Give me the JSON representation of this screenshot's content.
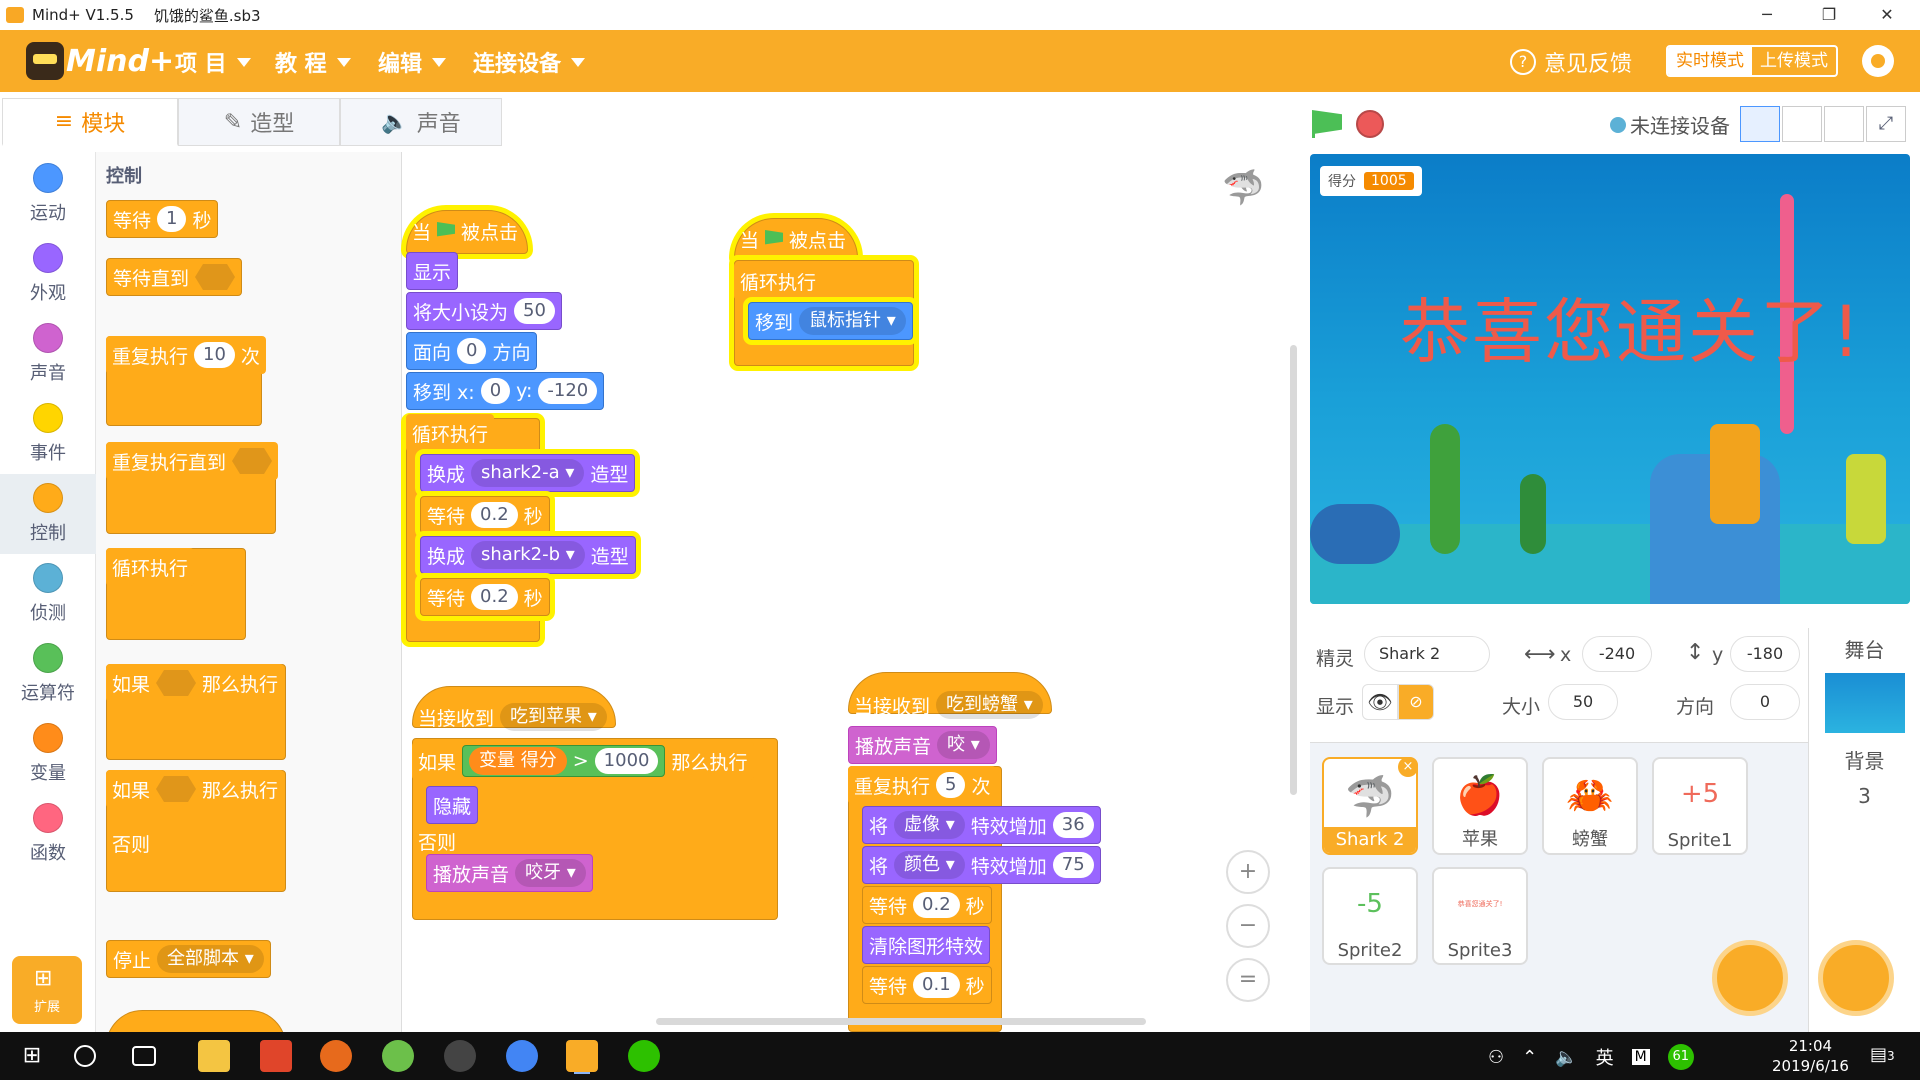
{
  "window": {
    "app": "Mind+ V1.5.5",
    "file": "饥饿的鲨鱼.sb3",
    "min": "─",
    "restore": "❐",
    "close": "✕"
  },
  "menubar": {
    "logo": "Mind+",
    "items": [
      "项 目",
      "教 程",
      "编辑",
      "连接设备"
    ],
    "feedback": "意见反馈",
    "mode_live": "实时模式",
    "mode_upload": "上传模式"
  },
  "tabs": [
    {
      "icon": "≡",
      "label": "模块"
    },
    {
      "icon": "✎",
      "label": "造型"
    },
    {
      "icon": "🔈",
      "label": "声音"
    }
  ],
  "categories": [
    {
      "label": "运动",
      "color": "#4c97ff"
    },
    {
      "label": "外观",
      "color": "#9966ff"
    },
    {
      "label": "声音",
      "color": "#cf63cf"
    },
    {
      "label": "事件",
      "color": "#ffd500"
    },
    {
      "label": "控制",
      "color": "#ffab19"
    },
    {
      "label": "侦测",
      "color": "#5cb1d6"
    },
    {
      "label": "运算符",
      "color": "#59c059"
    },
    {
      "label": "变量",
      "color": "#ff8c1a"
    },
    {
      "label": "函数",
      "color": "#ff6680"
    }
  ],
  "extensions_label": "扩展",
  "palette": {
    "heading": "控制",
    "wait": "等待",
    "wait_val": "1",
    "sec": "秒",
    "wait_until": "等待直到",
    "repeat": "重复执行",
    "repeat_val": "10",
    "times": "次",
    "repeat_until": "重复执行直到",
    "forever": "循环执行",
    "if": "如果",
    "then": "那么执行",
    "else": "否则",
    "stop": "停止",
    "stop_opt": "全部脚本"
  },
  "scripts": {
    "s1": {
      "when": "当",
      "clicked": "被点击",
      "show": "显示",
      "setsize": "将大小设为",
      "size_val": "50",
      "point": "面向",
      "dir_val": "0",
      "dir": "方向",
      "goto": "移到 x:",
      "x_val": "0",
      "y": "y:",
      "y_val": "-120",
      "forever": "循环执行",
      "switch": "换成",
      "costume_a": "shark2-a",
      "costume": "造型",
      "wait": "等待",
      "wait_val": "0.2",
      "sec": "秒",
      "costume_b": "shark2-b"
    },
    "s2": {
      "when": "当",
      "clicked": "被点击",
      "forever": "循环执行",
      "goto": "移到",
      "target": "鼠标指针"
    },
    "s3": {
      "recv": "当接收到",
      "msg": "吃到苹果",
      "if": "如果",
      "var": "变量",
      "varname": "得分",
      "gt": ">",
      "num": "1000",
      "then": "那么执行",
      "hide": "隐藏",
      "else": "否则",
      "play": "播放声音",
      "sound": "咬牙"
    },
    "s4": {
      "recv": "当接收到",
      "msg": "吃到螃蟹",
      "play": "播放声音",
      "sound": "咬",
      "repeat": "重复执行",
      "rep_val": "5",
      "times": "次",
      "set": "将",
      "eff1": "虚像",
      "inc": "特效增加",
      "v1": "36",
      "eff2": "颜色",
      "v2": "75",
      "wait": "等待",
      "w1": "0.2",
      "sec": "秒",
      "clear": "清除图形特效",
      "w2": "0.1"
    }
  },
  "zoom": {
    "in": "+",
    "out": "−",
    "reset": "="
  },
  "stage": {
    "connection": "未连接设备",
    "score_label": "得分",
    "score_value": "1005",
    "message": "恭喜您通关了!"
  },
  "sprite_info": {
    "sprite_label": "精灵",
    "sprite_name": "Shark 2",
    "x_label": "x",
    "x_val": "-240",
    "y_label": "y",
    "y_val": "-180",
    "show_label": "显示",
    "size_label": "大小",
    "size_val": "50",
    "dir_label": "方向",
    "dir_val": "0"
  },
  "sprites": [
    {
      "name": "Shark 2",
      "thumb": "🦈"
    },
    {
      "name": "苹果",
      "thumb": "🍎"
    },
    {
      "name": "螃蟹",
      "thumb": "🦀"
    },
    {
      "name": "Sprite1",
      "thumb": "+5"
    },
    {
      "name": "Sprite2",
      "thumb": "-5"
    },
    {
      "name": "Sprite3",
      "thumb": "恭喜您通关了!"
    }
  ],
  "stage_panel": {
    "title": "舞台",
    "bg_label": "背景",
    "bg_count": "3"
  },
  "taskbar": {
    "ime": "英",
    "battery": "61",
    "time": "21:04",
    "date": "2019/6/16",
    "notify": "3"
  }
}
